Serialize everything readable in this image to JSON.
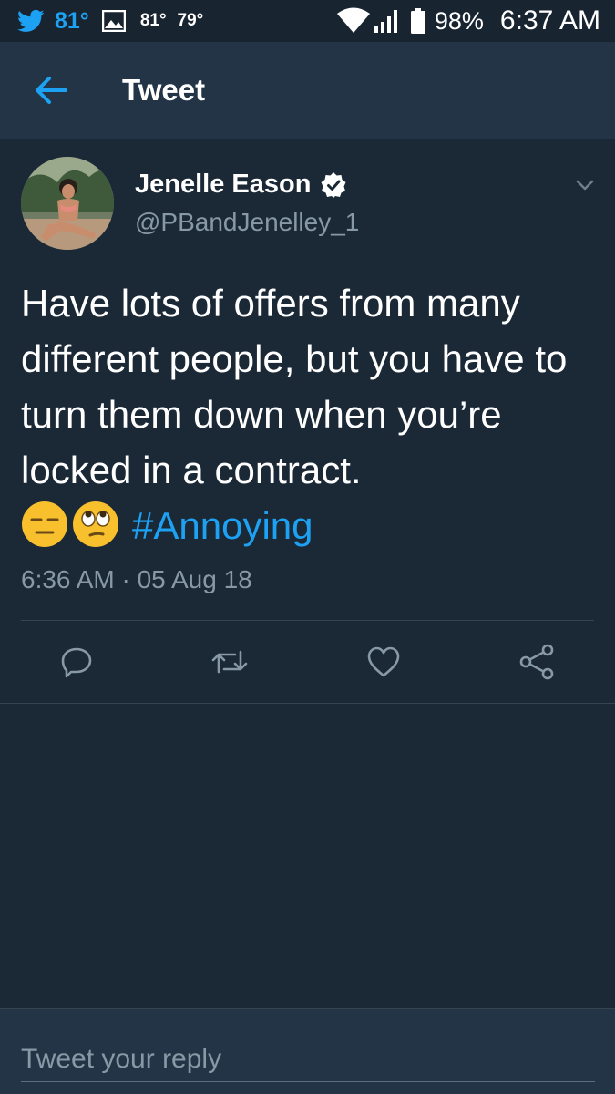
{
  "status_bar": {
    "temp_main": "81°",
    "temp_a": "81°",
    "temp_b": "79°",
    "battery_pct": "98%",
    "time": "6:37 AM",
    "icons": [
      "twitter-bird-icon",
      "image-icon",
      "wifi-icon",
      "signal-icon",
      "battery-icon"
    ]
  },
  "header": {
    "title": "Tweet",
    "back_icon": "arrow-left-icon"
  },
  "tweet": {
    "author_name": "Jenelle Eason",
    "author_handle": "@PBandJenelley_1",
    "text": "Have lots of offers from many different people, but you have to turn them down when you’re locked in a contract.",
    "emojis": [
      "expressionless-face-icon",
      "eye-roll-face-icon"
    ],
    "hashtag": "#Annoying",
    "timestamp": "6:36 AM · 05 Aug 18"
  },
  "actions": [
    "reply-icon",
    "retweet-icon",
    "like-icon",
    "share-icon"
  ],
  "reply": {
    "placeholder": "Tweet your reply"
  },
  "colors": {
    "background": "#1b2836",
    "header": "#243447",
    "accent": "#1da1f2",
    "secondary_text": "#8899a6"
  }
}
